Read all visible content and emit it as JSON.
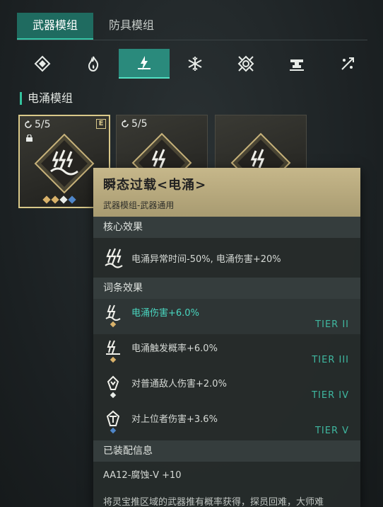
{
  "tabs": [
    {
      "label": "武器模组",
      "active": true
    },
    {
      "label": "防具模组",
      "active": false
    }
  ],
  "icon_bar": [
    {
      "name": "general-module-icon",
      "active": false
    },
    {
      "name": "burn-module-icon",
      "active": false
    },
    {
      "name": "surge-module-icon",
      "active": true
    },
    {
      "name": "frost-module-icon",
      "active": false
    },
    {
      "name": "shield-module-icon",
      "active": false
    },
    {
      "name": "anvil-module-icon",
      "active": false
    },
    {
      "name": "bounce-module-icon",
      "active": false
    }
  ],
  "section_title": "电涌模组",
  "cards": [
    {
      "count": "5/5",
      "badge": "E",
      "selected": true
    },
    {
      "count": "5/5",
      "badge": "",
      "selected": false
    },
    {
      "count": "",
      "badge": "",
      "selected": false
    }
  ],
  "tooltip": {
    "title": "瞬态过载<电涌>",
    "subtitle": "武器模组-武器通用",
    "core_heading": "核心效果",
    "core_effect": "电涌异常时间-50%, 电涌伤害+20%",
    "stats_heading": "词条效果",
    "stats": [
      {
        "text": "电涌伤害+6.0%",
        "tier": "TIER II",
        "highlight": true
      },
      {
        "text": "电涌触发概率+6.0%",
        "tier": "TIER III",
        "highlight": false
      },
      {
        "text": "对普通敌人伤害+2.0%",
        "tier": "TIER IV",
        "highlight": false
      },
      {
        "text": "对上位者伤害+3.6%",
        "tier": "TIER V",
        "highlight": false
      }
    ],
    "equip_heading": "已装配信息",
    "equip_value": "AA12-腐蚀-V +10",
    "description": "将灵宝推区域的武器推有概率获得，探员回难，大师难"
  },
  "colors": {
    "accent": "#2a8a7c",
    "gold": "#c6b78a",
    "tier": "#3fb8a0",
    "highlight": "#49d6c0"
  }
}
